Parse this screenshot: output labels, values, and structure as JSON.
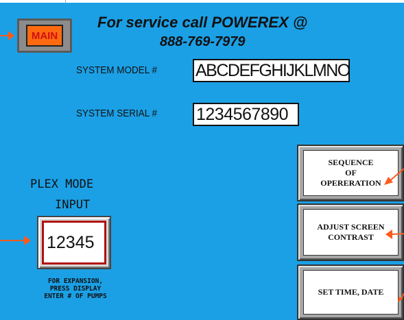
{
  "header": {
    "service_line1": "For service call POWEREX @",
    "service_line2": "888-769-7979"
  },
  "main_button": {
    "label": "MAIN"
  },
  "system": {
    "model_label": "SYSTEM MODEL #",
    "model_value": "ABCDEFGHIJKLMNO",
    "serial_label": "SYSTEM SERIAL #",
    "serial_value": "1234567890"
  },
  "plex": {
    "title_line1": "PLEX MODE",
    "title_line2": "INPUT",
    "value": "12345",
    "note_line1": "FOR EXPANSION,",
    "note_line2": "PRESS DISPLAY",
    "note_line3": "ENTER # OF PUMPS"
  },
  "side_buttons": {
    "sequence_line1": "SEQUENCE",
    "sequence_line2": "OF",
    "sequence_line3": "OPERERATION",
    "contrast_line1": "ADJUST SCREEN",
    "contrast_line2": "CONTRAST",
    "time_label": "SET TIME, DATE"
  },
  "colors": {
    "background": "#1ba0e6",
    "main_button": "#ff6a10",
    "arrow": "#ff5a1a",
    "plex_border": "#b01010"
  },
  "icons": [
    "arrow-icon"
  ]
}
